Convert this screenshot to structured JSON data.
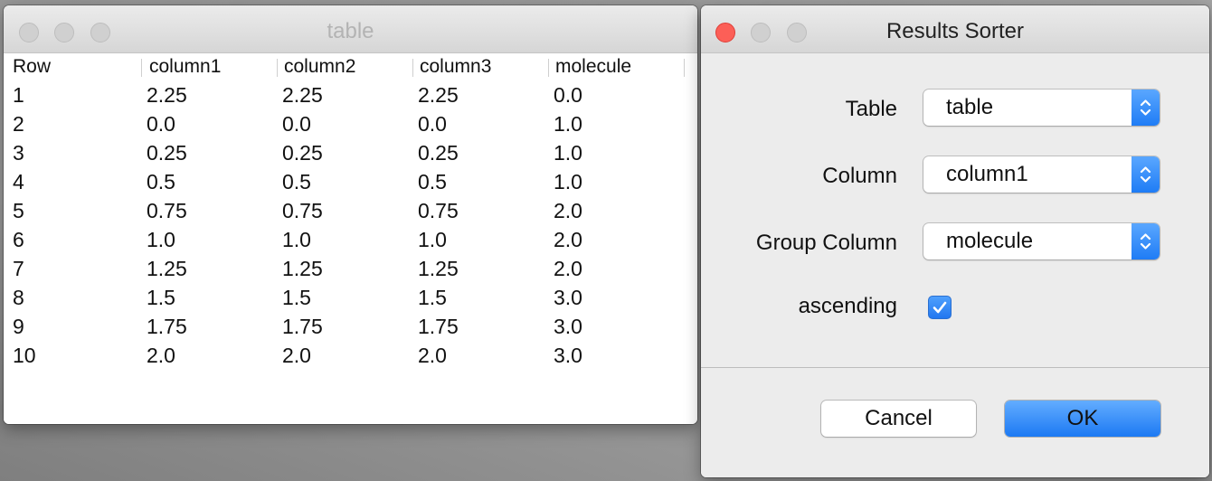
{
  "table_window": {
    "title": "table",
    "columns": [
      "Row",
      "column1",
      "column2",
      "column3",
      "molecule"
    ],
    "rows": [
      [
        "1",
        "2.25",
        "2.25",
        "2.25",
        "0.0"
      ],
      [
        "2",
        "0.0",
        "0.0",
        "0.0",
        "1.0"
      ],
      [
        "3",
        "0.25",
        "0.25",
        "0.25",
        "1.0"
      ],
      [
        "4",
        "0.5",
        "0.5",
        "0.5",
        "1.0"
      ],
      [
        "5",
        "0.75",
        "0.75",
        "0.75",
        "2.0"
      ],
      [
        "6",
        "1.0",
        "1.0",
        "1.0",
        "2.0"
      ],
      [
        "7",
        "1.25",
        "1.25",
        "1.25",
        "2.0"
      ],
      [
        "8",
        "1.5",
        "1.5",
        "1.5",
        "3.0"
      ],
      [
        "9",
        "1.75",
        "1.75",
        "1.75",
        "3.0"
      ],
      [
        "10",
        "2.0",
        "2.0",
        "2.0",
        "3.0"
      ]
    ]
  },
  "sorter_window": {
    "title": "Results Sorter",
    "fields": {
      "table": {
        "label": "Table",
        "value": "table"
      },
      "column": {
        "label": "Column",
        "value": "column1"
      },
      "group_column": {
        "label": "Group Column",
        "value": "molecule"
      },
      "ascending": {
        "label": "ascending",
        "checked": true
      }
    },
    "buttons": {
      "cancel": "Cancel",
      "ok": "OK"
    }
  },
  "colors": {
    "accent": "#1f7cf5",
    "close_button": "#fc5f57"
  }
}
